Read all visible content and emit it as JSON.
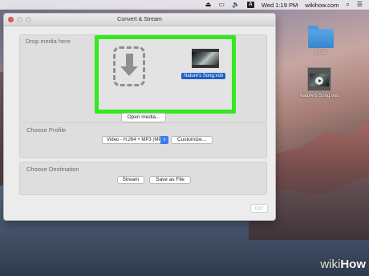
{
  "menubar": {
    "clock": "Wed 1:19 PM",
    "user": "wikihow.com",
    "icons": [
      "eject-icon",
      "display-icon",
      "volume-icon",
      "badge-a-icon",
      "search-icon",
      "menu-list-icon"
    ],
    "badge_letter": "A"
  },
  "desktop": {
    "folder_label": "Docs",
    "file_label": "Nature's Song.vob"
  },
  "window": {
    "title": "Convert & Stream",
    "drop": {
      "title": "Drop media here",
      "open_button": "Open media...",
      "file_name": "Nature's Song.vob"
    },
    "profile": {
      "title": "Choose Profile",
      "selected": "Video - H.264 + MP3 (MP4)",
      "customize_button": "Customize..."
    },
    "destination": {
      "title": "Choose Destination",
      "stream_button": "Stream",
      "save_button": "Save as File"
    },
    "go_button": "Go!"
  },
  "watermark": {
    "wiki": "wiki",
    "how": "How"
  },
  "colors": {
    "highlight_border": "#35e81f",
    "selection_blue": "#1e5ec8",
    "close_red": "#ee5a52"
  }
}
